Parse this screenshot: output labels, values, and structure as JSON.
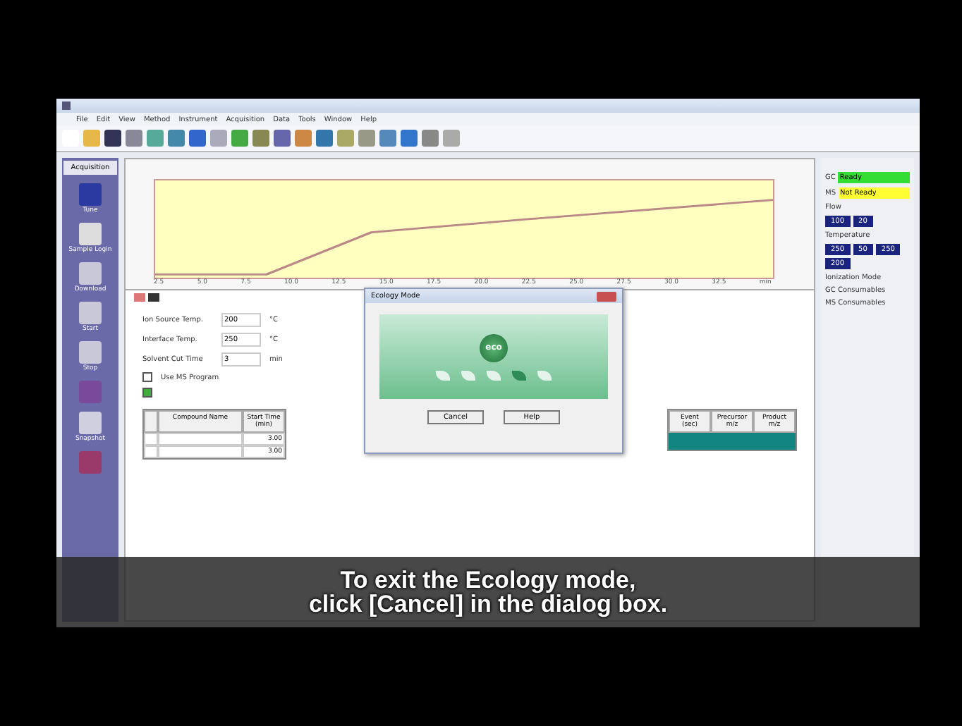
{
  "menu": [
    "File",
    "Edit",
    "View",
    "Method",
    "Instrument",
    "Acquisition",
    "Data",
    "Tools",
    "Window",
    "Help"
  ],
  "sidebar": {
    "title": "Acquisition",
    "items": [
      {
        "label": "Tune",
        "kind": "phone"
      },
      {
        "label": "Sample Login",
        "kind": "printer"
      },
      {
        "label": "Download",
        "kind": "power"
      },
      {
        "label": "Start",
        "kind": "power"
      },
      {
        "label": "Stop",
        "kind": "power"
      },
      {
        "kind": "flask"
      },
      {
        "label": "Snapshot",
        "kind": "grid"
      },
      {
        "kind": "disc"
      }
    ]
  },
  "chart": {
    "xticks": [
      "2.5",
      "5.0",
      "7.5",
      "10.0",
      "12.5",
      "15.0",
      "17.5",
      "20.0",
      "22.5",
      "25.0",
      "27.5",
      "30.0",
      "32.5"
    ],
    "unit": "min"
  },
  "form": {
    "fields": [
      {
        "label": "Ion Source Temp.",
        "value": "200",
        "unit": "°C"
      },
      {
        "label": "Interface Temp.",
        "value": "250",
        "unit": "°C"
      },
      {
        "label": "Solvent Cut Time",
        "value": "3",
        "unit": "min"
      }
    ],
    "checks": [
      {
        "label": "Use MS Program",
        "checked": false
      },
      {
        "checked": true
      }
    ]
  },
  "table": {
    "columns": [
      "",
      "Compound Name",
      "Start Time (min)"
    ],
    "columns_right": [
      "Event (sec)",
      "Precursor m/z",
      "Product m/z"
    ],
    "rows": [
      {
        "start": "3.00"
      },
      {
        "start": "3.00"
      }
    ]
  },
  "status": [
    {
      "label": "GC",
      "value": "Ready",
      "color": "#33dd33"
    },
    {
      "label": "MS",
      "value": "Not Ready",
      "color": "#ffff33"
    }
  ],
  "panel": {
    "flow_title": "Flow",
    "flow": [
      "100",
      "20"
    ],
    "temp_title": "Temperature",
    "temps": [
      "250",
      "50",
      "250",
      "200"
    ],
    "sections": [
      "Ionization Mode",
      "GC Consumables",
      "MS Consumables"
    ]
  },
  "dialog": {
    "title": "Ecology Mode",
    "logo": "eco",
    "leaves": [
      {
        "selected": false
      },
      {
        "selected": false
      },
      {
        "selected": false
      },
      {
        "selected": true
      },
      {
        "selected": false
      }
    ],
    "buttons": [
      "Cancel",
      "Help"
    ]
  },
  "subtitle": [
    "To exit the Ecology mode,",
    "click [Cancel] in the dialog box."
  ]
}
